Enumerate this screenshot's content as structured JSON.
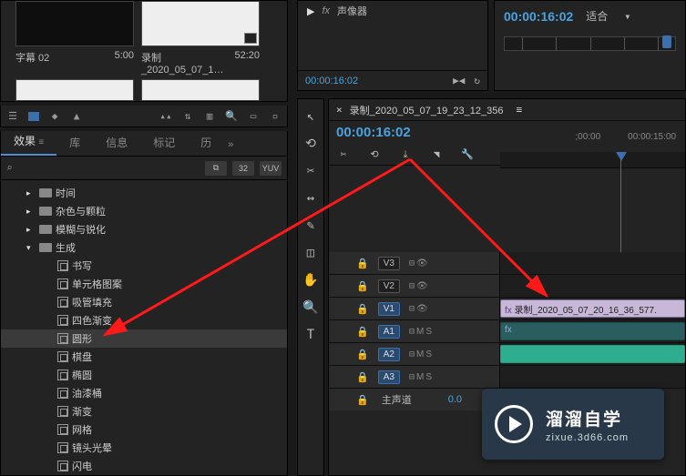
{
  "project": {
    "clips": [
      {
        "name": "字幕 02",
        "dur": "5:00"
      },
      {
        "name": "录制_2020_05_07_1…",
        "dur": "52:20"
      }
    ]
  },
  "fx": {
    "tabs": [
      "效果",
      "库",
      "信息",
      "标记",
      "历"
    ],
    "tab_suffix": "≡",
    "search_placeholder": "",
    "badges": [
      "⧉",
      "32",
      "YUV"
    ],
    "folders": [
      {
        "label": "时间",
        "depth": 1,
        "open": false,
        "type": "folder"
      },
      {
        "label": "杂色与颗粒",
        "depth": 1,
        "open": false,
        "type": "folder"
      },
      {
        "label": "模糊与锐化",
        "depth": 1,
        "open": false,
        "type": "folder"
      },
      {
        "label": "生成",
        "depth": 1,
        "open": true,
        "type": "folder"
      },
      {
        "label": "书写",
        "depth": 2,
        "type": "preset"
      },
      {
        "label": "单元格图案",
        "depth": 2,
        "type": "preset"
      },
      {
        "label": "吸管填充",
        "depth": 2,
        "type": "preset"
      },
      {
        "label": "四色渐变",
        "depth": 2,
        "type": "preset"
      },
      {
        "label": "圆形",
        "depth": 2,
        "type": "preset",
        "selected": true
      },
      {
        "label": "棋盘",
        "depth": 2,
        "type": "preset"
      },
      {
        "label": "椭圆",
        "depth": 2,
        "type": "preset"
      },
      {
        "label": "油漆桶",
        "depth": 2,
        "type": "preset"
      },
      {
        "label": "渐变",
        "depth": 2,
        "type": "preset"
      },
      {
        "label": "网格",
        "depth": 2,
        "type": "preset"
      },
      {
        "label": "镜头光晕",
        "depth": 2,
        "type": "preset"
      },
      {
        "label": "闪电",
        "depth": 2,
        "type": "preset"
      }
    ]
  },
  "effect_controls": {
    "item": "声像器",
    "timecode": "00:00:16:02"
  },
  "program": {
    "timecode": "00:00:16:02",
    "zoom": "适合"
  },
  "timeline": {
    "seq_name": "录制_2020_05_07_19_23_12_356",
    "timecode": "00:00:16:02",
    "ruler": [
      ";00:00",
      "00:00:15:00"
    ],
    "video_tracks": [
      {
        "id": "V3",
        "on": false
      },
      {
        "id": "V2",
        "on": false
      },
      {
        "id": "V1",
        "on": true
      }
    ],
    "audio_tracks": [
      {
        "id": "A1",
        "on": true
      },
      {
        "id": "A2",
        "on": true
      },
      {
        "id": "A3",
        "on": true
      }
    ],
    "clip_v1": "录制_2020_05_07_20_16_36_577.",
    "master": {
      "label": "主声道",
      "value": "0.0"
    },
    "sync": "M",
    "solo": "S"
  },
  "watermark": {
    "cn": "溜溜自学",
    "en": "zixue.3d66.com"
  },
  "tools": [
    "↖",
    "⟲",
    "✂",
    "↔",
    "✎",
    "◫",
    "✋",
    "🔍",
    "T"
  ]
}
